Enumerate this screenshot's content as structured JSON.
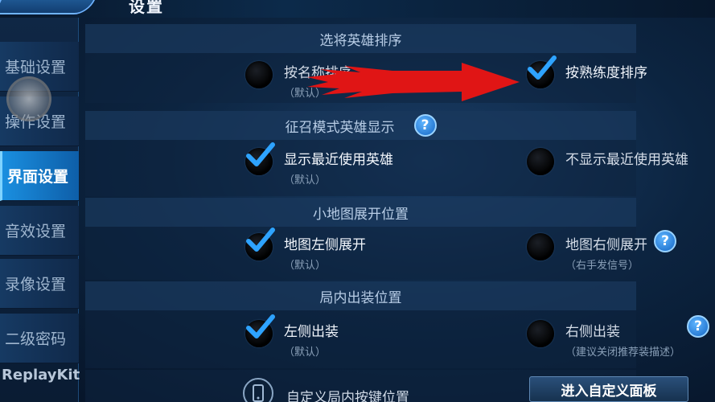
{
  "page_title": "设置",
  "sidebar": {
    "items": [
      {
        "label": "基础设置",
        "active": false
      },
      {
        "label": "操作设置",
        "active": false
      },
      {
        "label": "界面设置",
        "active": true
      },
      {
        "label": "音效设置",
        "active": false
      },
      {
        "label": "录像设置",
        "active": false
      },
      {
        "label": "二级密码",
        "active": false
      }
    ],
    "replaykit_label": "ReplayKit"
  },
  "sections": {
    "hero_sort": {
      "title": "选将英雄排序",
      "option_left": {
        "label": "按名称排序",
        "sub": "（默认）",
        "checked": false
      },
      "option_right": {
        "label": "按熟练度排序",
        "checked": true
      }
    },
    "recruit_display": {
      "title": "征召模式英雄显示",
      "help": "?",
      "option_left": {
        "label": "显示最近使用英雄",
        "sub": "（默认）",
        "checked": true
      },
      "option_right": {
        "label": "不显示最近使用英雄",
        "checked": false
      }
    },
    "minimap": {
      "title": "小地图展开位置",
      "option_left": {
        "label": "地图左侧展开",
        "sub": "（默认）",
        "checked": true
      },
      "option_right": {
        "label": "地图右侧展开",
        "sub": "（右手发信号）",
        "help": "?",
        "checked": false
      }
    },
    "equip": {
      "title": "局内出装位置",
      "option_left": {
        "label": "左侧出装",
        "sub": "（默认）",
        "checked": true
      },
      "option_right": {
        "label": "右侧出装",
        "sub": "（建议关闭推荐装描述）",
        "help": "?",
        "checked": false
      }
    },
    "custom_keys": {
      "label": "自定义局内按键位置",
      "button": "进入自定义面板"
    }
  },
  "colors": {
    "accent": "#1a8fe0",
    "check": "#2ea3ff",
    "arrow": "#e01515"
  }
}
